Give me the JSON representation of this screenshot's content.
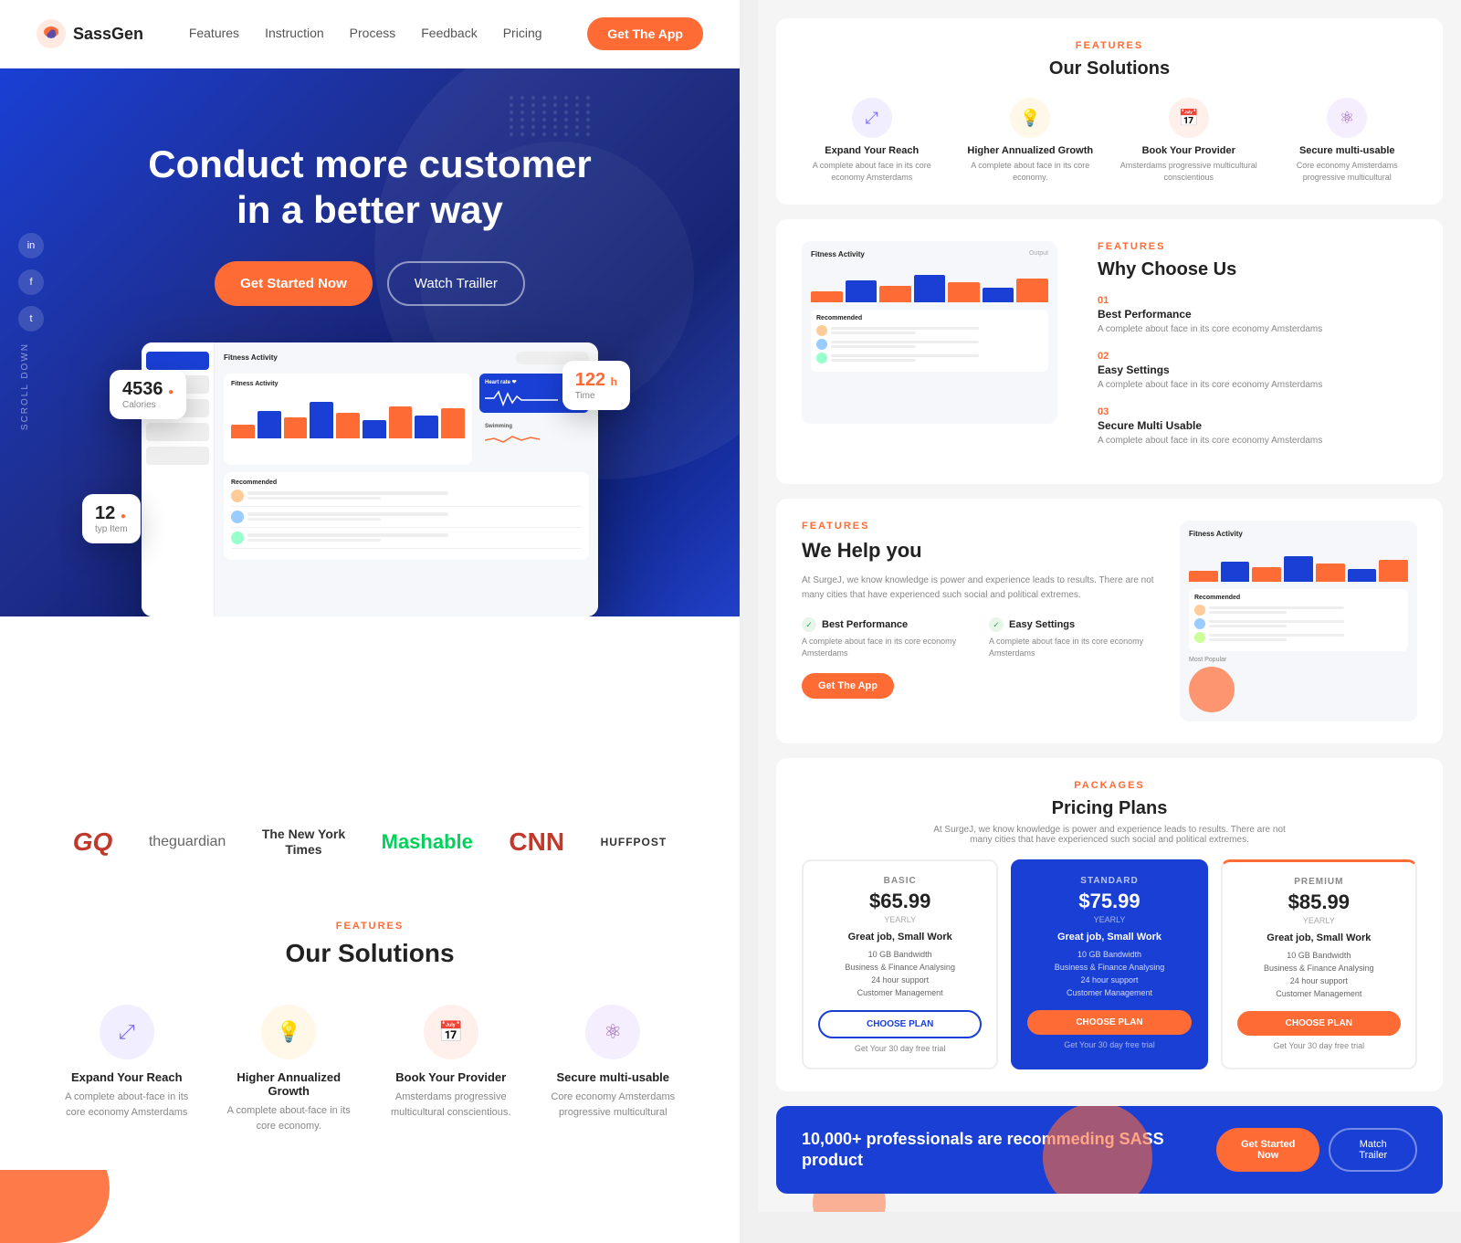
{
  "brand": {
    "name": "SassGen",
    "logoColor": "#ff6b35"
  },
  "nav": {
    "links": [
      "Features",
      "Instruction",
      "Process",
      "Feedback",
      "Pricing"
    ],
    "cta_button": "Get The App"
  },
  "hero": {
    "title_line1": "Conduct more customer",
    "title_line2": "in a better way",
    "btn_started": "Get Started Now",
    "btn_trailer": "Watch Trailler",
    "scroll_text": "SCROLL DOWN"
  },
  "social": {
    "icons": [
      "in",
      "f",
      "t"
    ]
  },
  "floating_cards": {
    "calories": {
      "number": "4536",
      "label": "Calories"
    },
    "time": {
      "number": "122",
      "unit": "h",
      "label": "Time"
    },
    "item": {
      "number": "12",
      "unit": "typ",
      "label": "Item"
    }
  },
  "brands": [
    "GQ",
    "theguardian",
    "The New York Times",
    "Mashable",
    "CNN",
    "HUFFPOST"
  ],
  "features": {
    "tag": "FEATURES",
    "title": "Our Solutions",
    "items": [
      {
        "icon": "⤢",
        "title": "Expand Your Reach",
        "desc": "A complete about-face in its core economy Amsterdams"
      },
      {
        "icon": "💡",
        "title": "Higher Annualized Growth",
        "desc": "A complete about-face in its core economy."
      },
      {
        "icon": "📅",
        "title": "Book Your Provider",
        "desc": "Amsterdams progressive multicultural conscientious."
      },
      {
        "icon": "⚛",
        "title": "Secure multi-usable",
        "desc": "Core economy Amsterdams progressive multicultural"
      }
    ]
  },
  "rp": {
    "solutions": {
      "tag": "FEATURES",
      "title": "Our Solutions",
      "items": [
        {
          "icon": "⤢",
          "bg": "#f0eeff",
          "color": "#7c6ff7",
          "title": "Expand Your Reach",
          "desc": "A complete about face in its core economy Amsterdams"
        },
        {
          "icon": "💡",
          "bg": "#fff8e8",
          "color": "#f5a623",
          "title": "Higher Annualized Growth",
          "desc": "A complete about face in its core economy."
        },
        {
          "icon": "📅",
          "bg": "#fff0ec",
          "color": "#ff6b35",
          "title": "Book Your Provider",
          "desc": "Amsterdams progressive multicultural conscientious"
        },
        {
          "icon": "⚛",
          "bg": "#f5eeff",
          "color": "#9b59b6",
          "title": "Secure multi-usable",
          "desc": "Core economy Amsterdams progressive multicultural"
        }
      ]
    },
    "why": {
      "tag": "FEATURES",
      "title": "Why Choose Us",
      "items": [
        {
          "num": "01",
          "title": "Best Performance",
          "desc": "A complete about face in its core economy Amsterdams"
        },
        {
          "num": "02",
          "title": "Easy Settings",
          "desc": "A complete about face in its core economy Amsterdams"
        },
        {
          "num": "03",
          "title": "Secure Multi Usable",
          "desc": "A complete about face in its core economy Amsterdams"
        }
      ]
    },
    "help": {
      "tag": "FEATURES",
      "title": "We Help you",
      "desc": "At SurgeJ, we know knowledge is power and experience leads to results. There are not many cities that have experienced such social and political extremes.",
      "features": [
        {
          "icon": "✓",
          "title": "Best Performance",
          "desc": "A complete about face in its core economy Amsterdams"
        },
        {
          "icon": "✓",
          "title": "Easy Settings",
          "desc": "A complete about face in its core economy Amsterdams"
        }
      ],
      "btn": "Get The App"
    },
    "pricing": {
      "tag": "PACKAGES",
      "title": "Pricing Plans",
      "desc": "At SurgeJ, we know knowledge is power and experience leads to results. There are not many cities that have experienced such social and political extremes.",
      "plans": [
        {
          "name": "BASIC",
          "price": "$65.99",
          "period": "YEARLY",
          "label": "Great job, Small Work",
          "features": [
            "10 GB Bandwidth",
            "Business & Finance Analysing",
            "24 hour support",
            "Customer Management"
          ],
          "btn": "CHOOSE PLAN",
          "trial": "Get Your 30 day free trial",
          "type": "basic"
        },
        {
          "name": "STANDARD",
          "price": "$75.99",
          "period": "YEARLY",
          "label": "Great job, Small Work",
          "features": [
            "10 GB Bandwidth",
            "Business & Finance Analysing",
            "24 hour support",
            "Customer Management"
          ],
          "btn": "CHOOSE PLAN",
          "trial": "Get Your 30 day free trial",
          "type": "standard"
        },
        {
          "name": "PREMIUM",
          "price": "$85.99",
          "period": "YEARLY",
          "label": "Great job, Small Work",
          "features": [
            "10 GB Bandwidth",
            "Business & Finance Analysing",
            "24 hour support",
            "Customer Management"
          ],
          "btn": "CHOOSE PLAN",
          "trial": "Get Your 30 day free trial",
          "type": "premium"
        }
      ]
    },
    "cta": {
      "title": "10,000+ professionals are recommeding SASS product",
      "btn_started": "Get Started Now",
      "btn_trailer": "Match Trailer"
    }
  }
}
